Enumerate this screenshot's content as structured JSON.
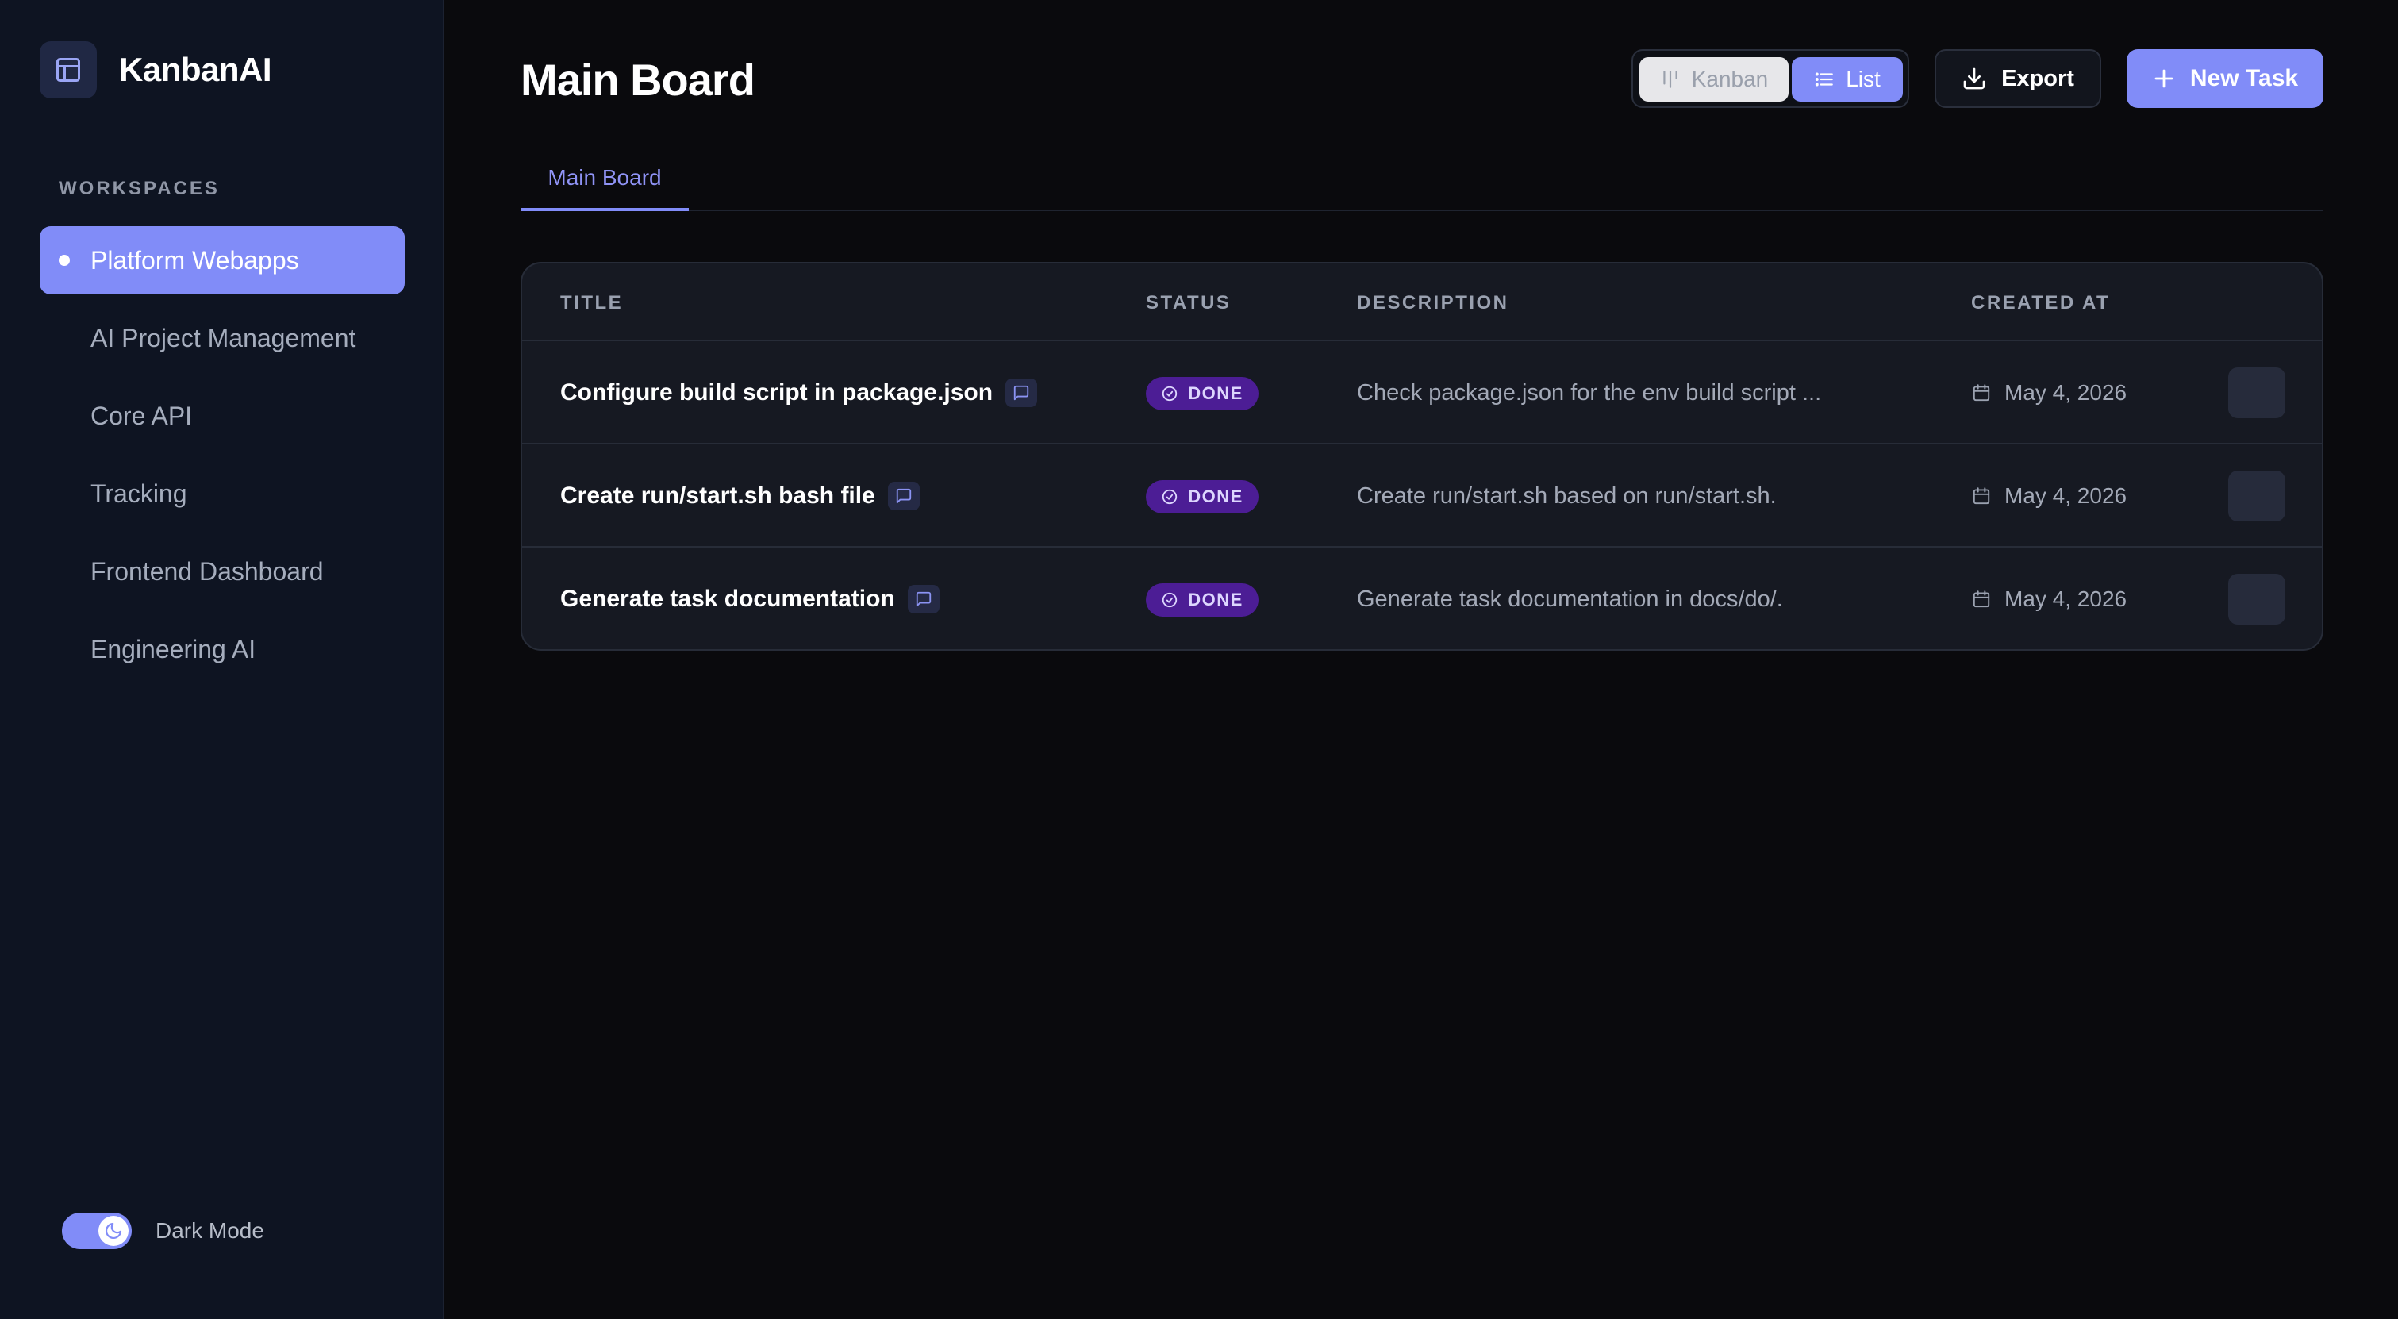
{
  "app": {
    "name": "KanbanAI"
  },
  "sidebar": {
    "heading": "WORKSPACES",
    "items": [
      {
        "label": "Platform Webapps",
        "active": true
      },
      {
        "label": "AI Project Management"
      },
      {
        "label": "Core API"
      },
      {
        "label": "Tracking"
      },
      {
        "label": "Frontend Dashboard"
      },
      {
        "label": "Engineering AI"
      }
    ],
    "dark_mode_label": "Dark Mode",
    "dark_mode_on": true
  },
  "header": {
    "title": "Main Board",
    "view_switch": {
      "kanban": "Kanban",
      "list": "List",
      "selected": "List"
    },
    "export_label": "Export",
    "new_task_label": "New Task"
  },
  "tabs": [
    {
      "label": "Main Board",
      "active": true
    }
  ],
  "table": {
    "columns": {
      "title": "TITLE",
      "status": "STATUS",
      "description": "DESCRIPTION",
      "created_at": "CREATED AT"
    },
    "rows": [
      {
        "title": "Configure build script in package.json",
        "status": "DONE",
        "description": "Check package.json for the env build script ...",
        "created_at": "May 4, 2026"
      },
      {
        "title": "Create run/start.sh bash file",
        "status": "DONE",
        "description": "Create run/start.sh based on run/start.sh.",
        "created_at": "May 4, 2026"
      },
      {
        "title": "Generate task documentation",
        "status": "DONE",
        "description": "Generate task documentation in docs/do/.",
        "created_at": "May 4, 2026"
      }
    ]
  },
  "colors": {
    "accent": "#818cf8",
    "background": "#0a0a0d",
    "sidebar": "#0e1422",
    "status_done_bg": "#4c1d95"
  },
  "icons": {
    "brand": "layout-icon",
    "kanban": "kanban-icon",
    "list": "list-icon",
    "export": "download-icon",
    "new_task": "plus-icon",
    "comment": "comment-icon",
    "status_done": "check-circle-icon",
    "created_at": "calendar-icon",
    "dark_mode": "moon-icon"
  }
}
